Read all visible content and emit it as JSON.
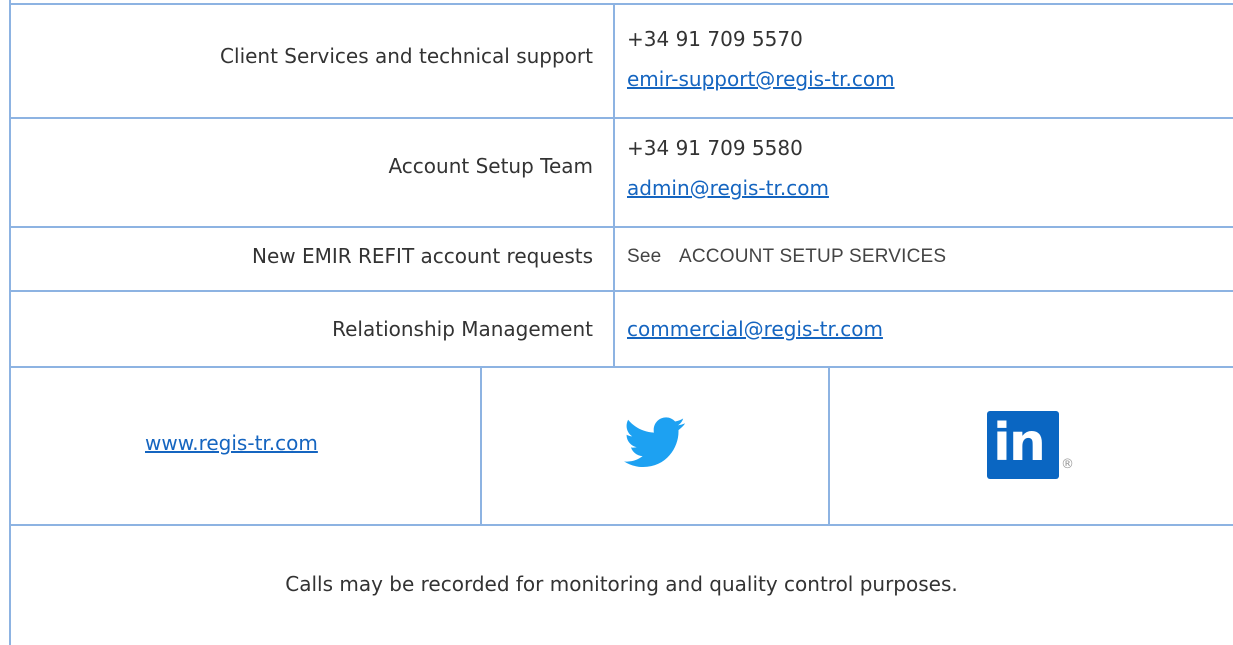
{
  "rows": [
    {
      "label": "Client Services and technical support",
      "phone": "+34 91 709 5570",
      "email": "emir-support@regis-tr.com"
    },
    {
      "label": "Account Setup Team",
      "phone": "+34 91 709 5580",
      "email": "admin@regis-tr.com"
    },
    {
      "label": "New EMIR REFIT account requests",
      "see_prefix": "See",
      "see_text": "ACCOUNT SETUP SERVICES"
    },
    {
      "label": "Relationship Management",
      "email": "commercial@regis-tr.com"
    }
  ],
  "links_row": {
    "website": "www.regis-tr.com",
    "twitter_icon": "twitter-bird-icon",
    "linkedin_icon": "linkedin-icon",
    "linkedin_text": "in",
    "linkedin_registered": "®"
  },
  "footer_note": "Calls may be recorded for monitoring and quality control purposes.",
  "colors": {
    "border": "#8db3e2",
    "link": "#1565c0",
    "text": "#333333",
    "twitter": "#1da1f2",
    "linkedin": "#0a66c2"
  }
}
